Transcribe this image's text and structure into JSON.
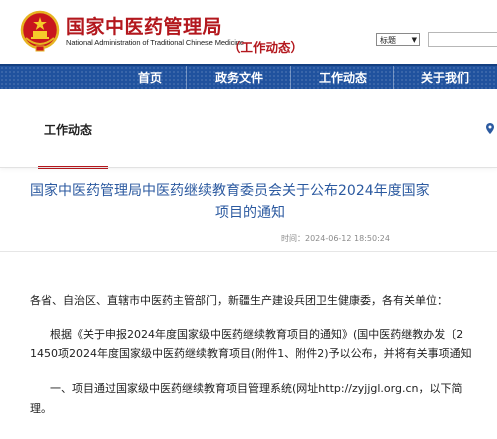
{
  "header": {
    "site_name_cn": "国家中医药管理局",
    "site_name_en": "National Administration of Traditional Chinese Medicine",
    "section": "（工作动态）",
    "select_value": "标题",
    "search_value": ""
  },
  "nav": {
    "items": [
      {
        "label": "首页"
      },
      {
        "label": "政务文件"
      },
      {
        "label": "工作动态"
      },
      {
        "label": "关于我们"
      }
    ]
  },
  "breadcrumb": {
    "current": "工作动态"
  },
  "article": {
    "title_line1": "国家中医药管理局中医药继续教育委员会关于公布2024年度国家",
    "title_line2": "项目的通知",
    "time_label": "时间：2024-06-12 18:50:24",
    "salutation": "各省、自治区、直辖市中医药主管部门，新疆生产建设兵团卫生健康委，各有关单位：",
    "para1_line1": "根据《关于申报2024年度国家级中医药继续教育项目的通知》(国中医药继教办发〔2",
    "para1_line2": "1450项2024年度国家级中医药继续教育项目(附件1、附件2)予以公布，并将有关事项通知",
    "para2_line1": "一、项目通过国家级中医药继续教育项目管理系统(网址http://zyjjgl.org.cn，以下简",
    "para2_line2": "理。"
  },
  "colors": {
    "brand_red": "#b3171d",
    "nav_blue": "#20529e",
    "title_blue": "#2c5aa0"
  }
}
